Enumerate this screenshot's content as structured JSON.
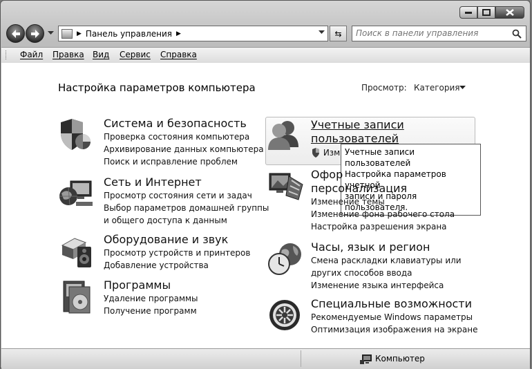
{
  "window": {
    "address": "Панель управления",
    "search_placeholder": "Поиск в панели управления"
  },
  "menu": {
    "items": [
      "Файл",
      "Правка",
      "Вид",
      "Сервис",
      "Справка"
    ]
  },
  "page": {
    "heading": "Настройка параметров компьютера",
    "view_label": "Просмотр:",
    "view_value": "Категория"
  },
  "categories": {
    "security": {
      "title": "Система и безопасность",
      "links": [
        "Проверка состояния компьютера",
        "Архивирование данных компьютера",
        "Поиск и исправление проблем"
      ]
    },
    "network": {
      "title": "Сеть и Интернет",
      "links": [
        "Просмотр состояния сети и задач",
        "Выбор параметров домашней группы",
        "и общего доступа к данным"
      ]
    },
    "hardware": {
      "title": "Оборудование и звук",
      "links": [
        "Просмотр устройств и принтеров",
        "Добавление устройства"
      ]
    },
    "programs": {
      "title": "Программы",
      "links": [
        "Удаление программы",
        "Получение программ"
      ]
    },
    "users": {
      "title_line1": "Учетные записи",
      "title_line2": "пользователей",
      "link_partial": "Изм"
    },
    "appearance": {
      "title_line1": "Офор",
      "title_line2": "персонализация",
      "links": [
        "Изменение темы",
        "Изменение фона рабочего стола",
        "Настройка разрешения экрана"
      ]
    },
    "clock": {
      "title": "Часы, язык и регион",
      "links": [
        "Смена раскладки клавиатуры или",
        "других способов ввода",
        "Изменение языка интерфейса"
      ]
    },
    "ease": {
      "title": "Специальные возможности",
      "links": [
        "Рекомендуемые Windows параметры",
        "Оптимизация изображения на экране"
      ]
    }
  },
  "tooltip": {
    "lines": [
      "Учетные записи пользователей",
      "Настройка параметров учетной",
      "записи и пароля пользователя."
    ]
  },
  "status": {
    "location": "Компьютер"
  }
}
